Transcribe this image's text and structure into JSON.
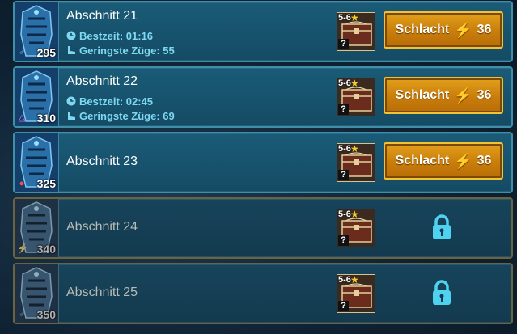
{
  "stages": [
    {
      "title": "Abschnitt 21",
      "level": "295",
      "affinity_icon": "magic-affinity-icon",
      "best_time_label": "Bestzeit: 01:16",
      "fewest_moves_label": "Geringste Züge: 55",
      "reward_range": "5-6",
      "reward_unknown": "?",
      "battle_label": "Schlacht",
      "energy_cost": "36",
      "locked": false
    },
    {
      "title": "Abschnitt 22",
      "level": "310",
      "affinity_icon": "spirit-affinity-icon",
      "best_time_label": "Bestzeit: 02:45",
      "fewest_moves_label": "Geringste Züge: 69",
      "reward_range": "5-6",
      "reward_unknown": "?",
      "battle_label": "Schlacht",
      "energy_cost": "36",
      "locked": false
    },
    {
      "title": "Abschnitt 23",
      "level": "325",
      "affinity_icon": "force-affinity-icon",
      "reward_range": "5-6",
      "reward_unknown": "?",
      "battle_label": "Schlacht",
      "energy_cost": "36",
      "locked": false
    },
    {
      "title": "Abschnitt 24",
      "level": "340",
      "affinity_icon": "void-affinity-icon",
      "reward_range": "5-6",
      "reward_unknown": "?",
      "locked": true
    },
    {
      "title": "Abschnitt 25",
      "level": "350",
      "affinity_icon": "magic-affinity-icon",
      "reward_range": "5-6",
      "reward_unknown": "?",
      "locked": true
    }
  ],
  "colors": {
    "stat_text": "#7fd8f2",
    "battle_button": "#d08a10",
    "lock": "#4fd2f0",
    "star": "#f4cf2b"
  }
}
